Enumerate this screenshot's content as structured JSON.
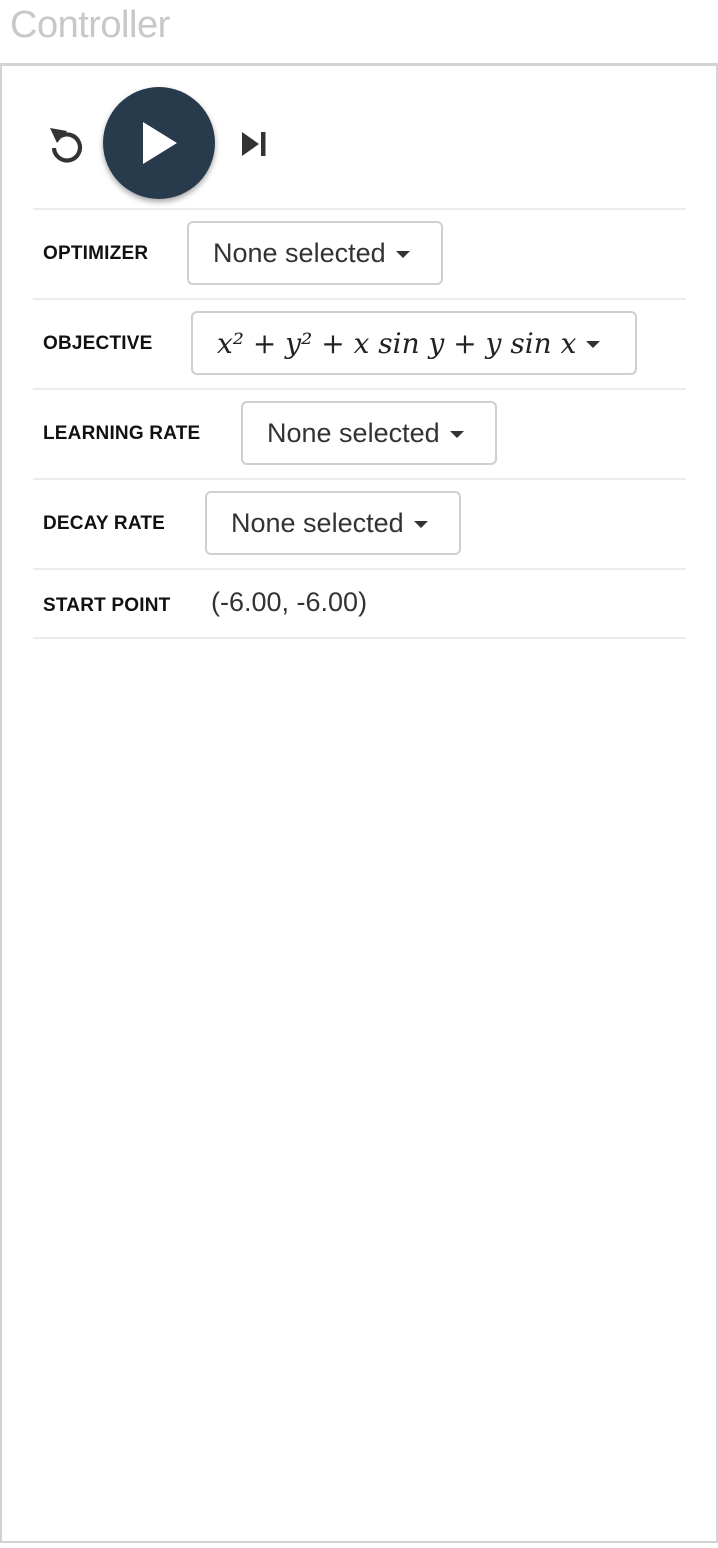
{
  "header": {
    "title": "Controller"
  },
  "controls": {
    "reset": {
      "icon": "reset-icon"
    },
    "play": {
      "icon": "play-icon",
      "color": "#283b4d"
    },
    "step": {
      "icon": "step-forward-icon"
    }
  },
  "settings": {
    "optimizer": {
      "label": "OPTIMIZER",
      "value": "None selected"
    },
    "objective": {
      "label": "OBJECTIVE",
      "value": "x² + y² + x sin y + y sin x"
    },
    "learning_rate": {
      "label": "LEARNING RATE",
      "value": "None selected"
    },
    "decay_rate": {
      "label": "DECAY RATE",
      "value": "None selected"
    },
    "start_point": {
      "label": "START POINT",
      "value": "(-6.00, -6.00)"
    }
  }
}
